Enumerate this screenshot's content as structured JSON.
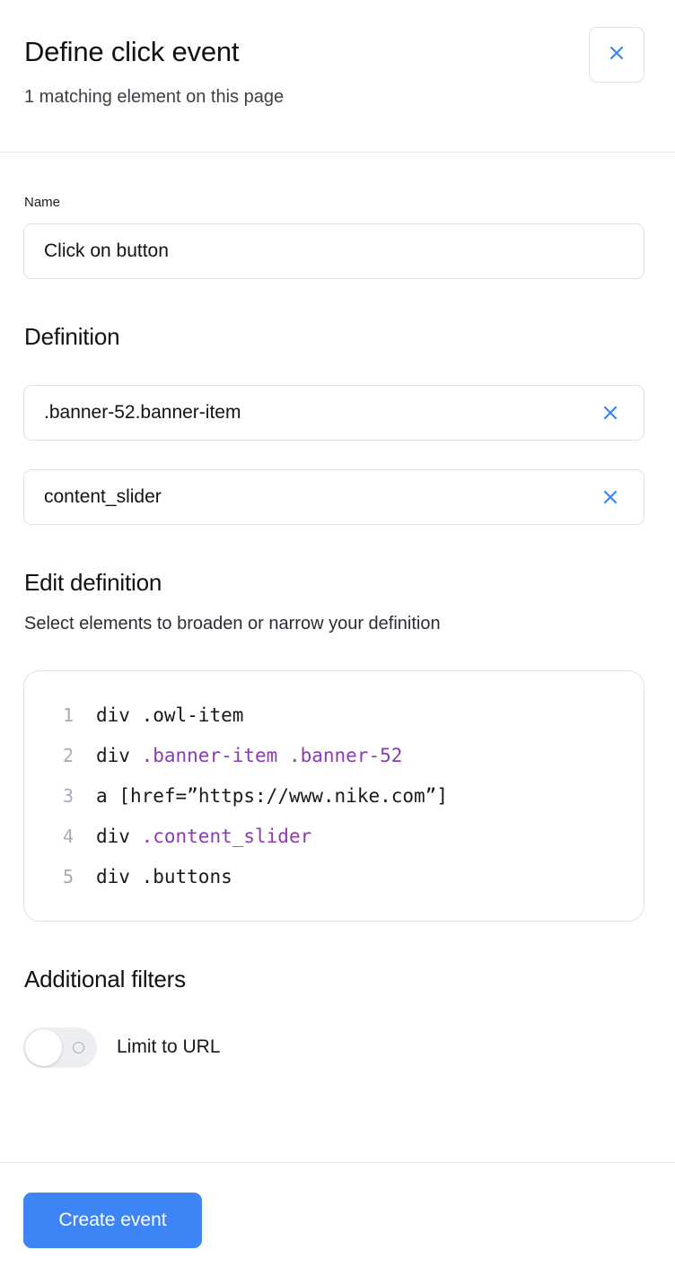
{
  "header": {
    "title": "Define click event",
    "subtitle": "1 matching element on this page",
    "close_icon": "close-icon"
  },
  "name_field": {
    "label": "Name",
    "value": "Click on button"
  },
  "definition": {
    "heading": "Definition",
    "selectors": [
      {
        "value": ".banner-52.banner-item"
      },
      {
        "value": "content_slider"
      }
    ]
  },
  "edit_definition": {
    "heading": "Edit definition",
    "description": "Select elements to broaden or narrow your definition",
    "lines": [
      {
        "num": "1",
        "tag": "div",
        "plain": ".owl-item",
        "selected": ""
      },
      {
        "num": "2",
        "tag": "div",
        "plain": "",
        "selected": ".banner-item .banner-52"
      },
      {
        "num": "3",
        "tag": "a",
        "plain": "[href=”https://www.nike.com”]",
        "selected": ""
      },
      {
        "num": "4",
        "tag": "div",
        "plain": "",
        "selected": ".content_slider"
      },
      {
        "num": "5",
        "tag": "div",
        "plain": ".buttons",
        "selected": ""
      }
    ]
  },
  "filters": {
    "heading": "Additional filters",
    "limit_to_url": {
      "label": "Limit to URL",
      "enabled": false
    }
  },
  "footer": {
    "create_label": "Create event"
  },
  "colors": {
    "accent": "#3d84f6",
    "selected_token": "#8a3cb0",
    "border": "#dfe1e6"
  }
}
